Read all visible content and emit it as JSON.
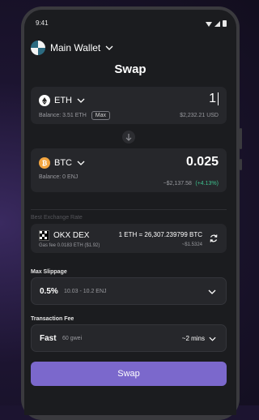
{
  "status_bar": {
    "time": "9:41"
  },
  "header": {
    "wallet_name": "Main Wallet"
  },
  "title": "Swap",
  "from": {
    "symbol": "ETH",
    "amount": "1",
    "balance": "Balance: 3.51 ETH",
    "max_label": "Max",
    "usd_value": "$2,232.21 USD"
  },
  "to": {
    "symbol": "BTC",
    "amount": "0.025",
    "balance": "Balance: 0 ENJ",
    "usd_value": "~$2,137.58",
    "change": "(+4.13%)"
  },
  "best_rate": {
    "label": "Best Exchange Rate",
    "dex_name": "OKX DEX",
    "gas_fee": "Gas fee 0.0183 ETH ($1.92)",
    "rate": "1 ETH = 26,307.239799 BTC",
    "rate_usd": "~$1.5324"
  },
  "slippage": {
    "label": "Max Slippage",
    "value": "0.5%",
    "range": "10.03 - 10.2 ENJ"
  },
  "fee": {
    "label": "Transaction Fee",
    "speed": "Fast",
    "gwei": "60 gwei",
    "time": "~2 mins"
  },
  "swap_button": "Swap",
  "colors": {
    "accent": "#7b68cc",
    "positive": "#3ec28f",
    "eth_icon": "#ffffff",
    "btc_icon": "#f4a640"
  }
}
